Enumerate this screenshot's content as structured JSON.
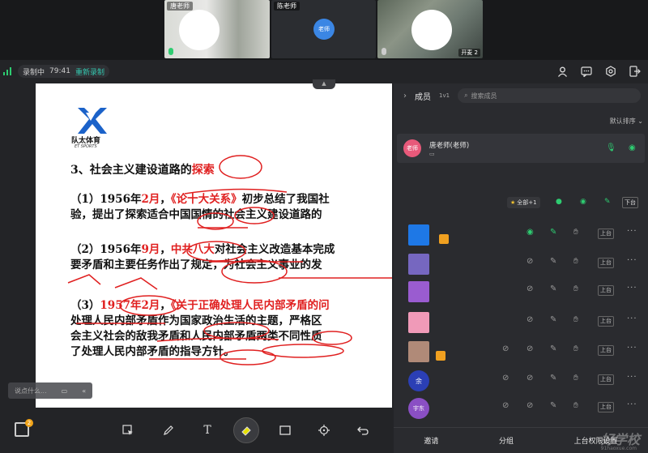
{
  "video": {
    "tile1_name": "唐老师",
    "tile2_name": "陈老师",
    "tile2_avatar": "老师",
    "tile3_tag": "开麦 2"
  },
  "toolbar": {
    "recording_label": "录制中",
    "recording_time": "79:41",
    "rerecord_label": "重新录制",
    "icons": [
      "user-icon",
      "chat-icon",
      "settings-icon",
      "exit-icon"
    ]
  },
  "slide": {
    "logo_text": "队太体育",
    "logo_sub": "ET SPORTS",
    "title_a": "3、社会主义建设道路的",
    "title_b": "探索",
    "p1_l1_a": "（1）1956年",
    "p1_l1_b": "2月",
    "p1_l1_c": "，",
    "p1_l1_d": "《论十大关系》",
    "p1_l1_e": "初步总结了我国社",
    "p1_l2": "验，提出了探索适合中国国情的社会主义建设道路的",
    "p2_l1_a": "（2）1956年",
    "p2_l1_b": "9月",
    "p2_l1_c": "，",
    "p2_l1_d": "中共八大",
    "p2_l1_e": "对社会主义改造基本完成",
    "p2_l2": "要矛盾和主要任务作出了规定，为社会主义事业的发",
    "p3_l1_a": "（3）",
    "p3_l1_b": "1957年2月",
    "p3_l1_c": "，",
    "p3_l1_d": "《关于正确处理人民内部矛盾的问",
    "p3_l2": "处理人民内部矛盾作为国家政治生活的主题，严格区",
    "p3_l3": "会主义社会的敌我矛盾和人民内部矛盾两类不同性质",
    "p3_l4": "了处理人民内部矛盾的指导方针。"
  },
  "chat": {
    "placeholder": "说点什么..."
  },
  "panel": {
    "title": "成员",
    "count": "1v1",
    "search_placeholder": "搜索成员",
    "sort_label": "默认排序",
    "teacher_avatar": "老师",
    "teacher_name": "唐老师(老师)",
    "all_chip": "全部+1",
    "down_label": "下台",
    "up_label": "上台",
    "footer": [
      "邀请",
      "分组",
      "上台权限设置"
    ],
    "row_avatars": [
      "余",
      "宇东"
    ]
  },
  "watermark": {
    "brand": "好学校",
    "url": "91haoxue.com"
  }
}
